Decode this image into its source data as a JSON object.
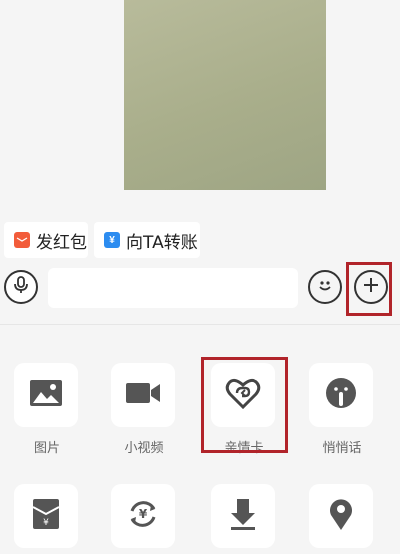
{
  "chat": {
    "image_message": "photo"
  },
  "quick_actions": {
    "hongbao": {
      "label": "发红包",
      "icon": "red-envelope-icon",
      "color": "#f25c3a"
    },
    "transfer": {
      "label": "向TA转账",
      "icon": "yen-icon",
      "color": "#2c8cf0"
    }
  },
  "input_bar": {
    "placeholder": "",
    "value": "",
    "mic_icon": "microphone-icon",
    "emoji_icon": "smiley-icon",
    "plus_icon": "plus-circle-icon",
    "highlight_color": "#b1242a"
  },
  "panel": {
    "tools": [
      {
        "label": "图片",
        "icon": "picture-icon"
      },
      {
        "label": "小视频",
        "icon": "video-camera-icon"
      },
      {
        "label": "亲情卡",
        "icon": "heart-card-icon"
      },
      {
        "label": "悄悄话",
        "icon": "whisper-icon"
      },
      {
        "label": "",
        "icon": "red-packet-icon"
      },
      {
        "label": "",
        "icon": "yen-exchange-icon"
      },
      {
        "label": "",
        "icon": "download-icon"
      },
      {
        "label": "",
        "icon": "location-pin-icon"
      }
    ]
  }
}
